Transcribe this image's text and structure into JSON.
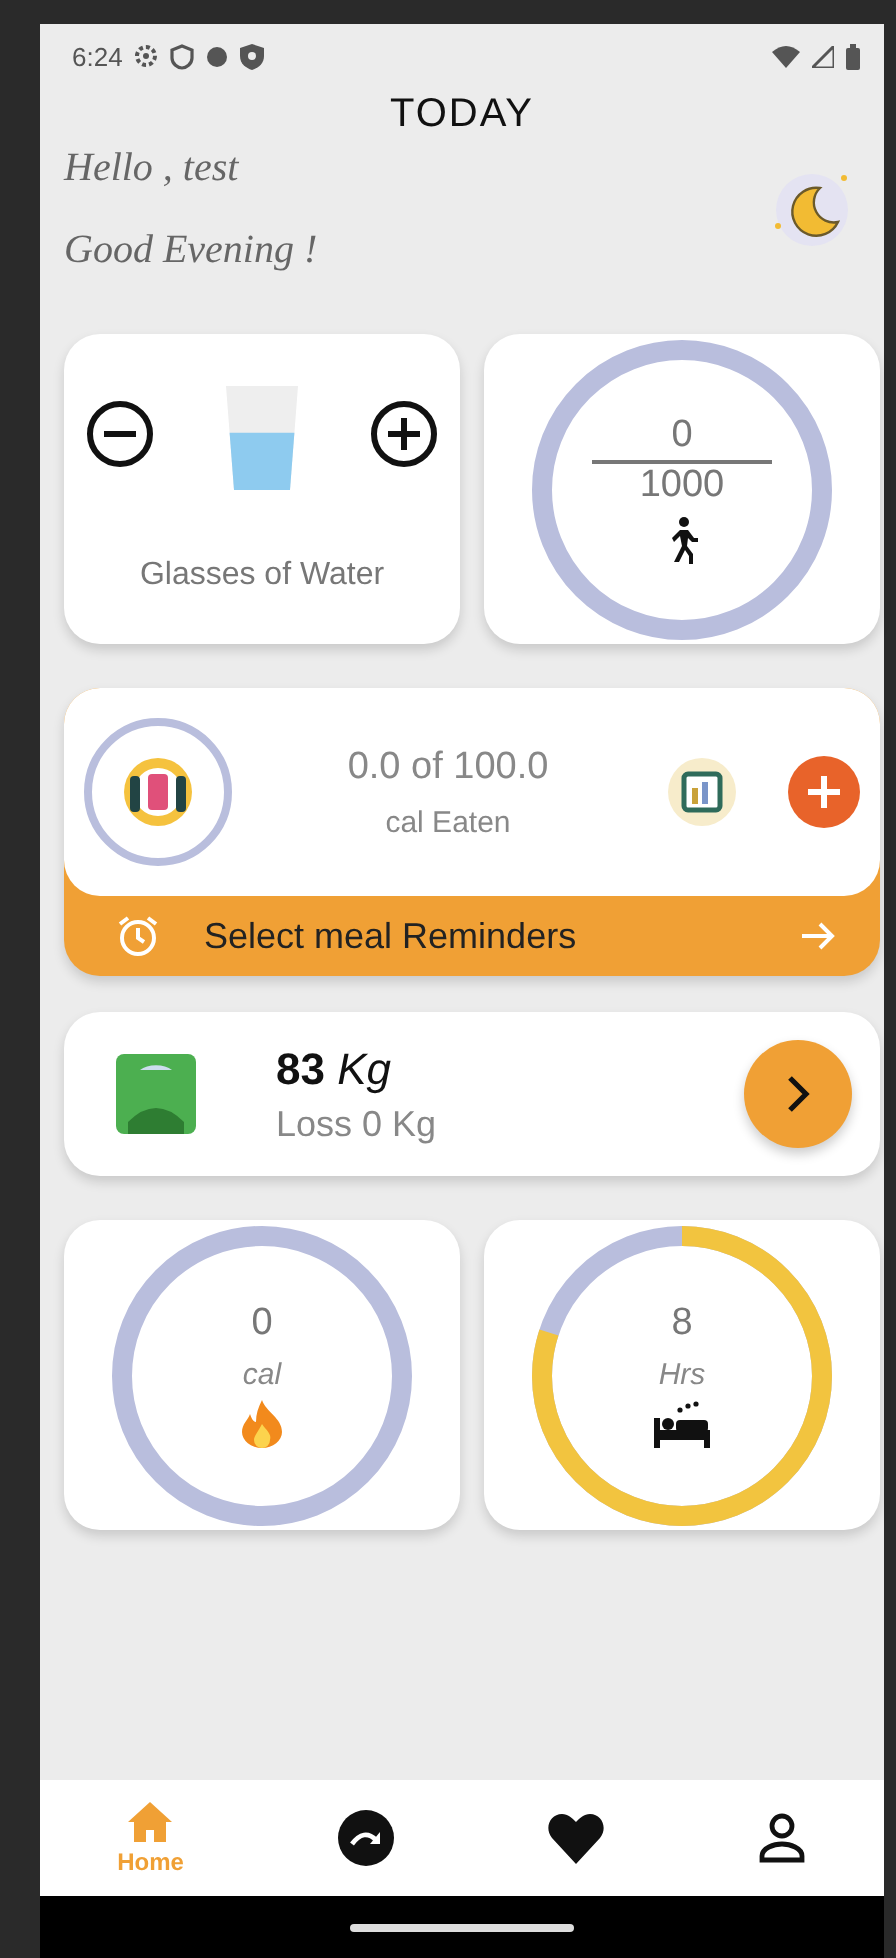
{
  "status_bar": {
    "time": "6:24"
  },
  "title": "TODAY",
  "greeting": {
    "hello": "Hello , test",
    "salutation": "Good Evening !"
  },
  "water": {
    "label": "Glasses of Water"
  },
  "steps": {
    "count": "0",
    "goal": "1000"
  },
  "meals": {
    "eaten": "0.0 of 100.0",
    "unit": "cal Eaten",
    "reminder": "Select meal Reminders"
  },
  "weight": {
    "value": "**83** *Kg*",
    "change": "Loss 0 Kg"
  },
  "calories": {
    "value": "0",
    "unit": "cal"
  },
  "sleep": {
    "value": "8",
    "unit": "Hrs"
  },
  "nav": [
    {
      "kind": "home",
      "label": "Home",
      "selected": true
    },
    {
      "kind": "progress",
      "selected": false
    },
    {
      "kind": "favorites",
      "selected": false
    },
    {
      "kind": "profile",
      "selected": false
    }
  ]
}
